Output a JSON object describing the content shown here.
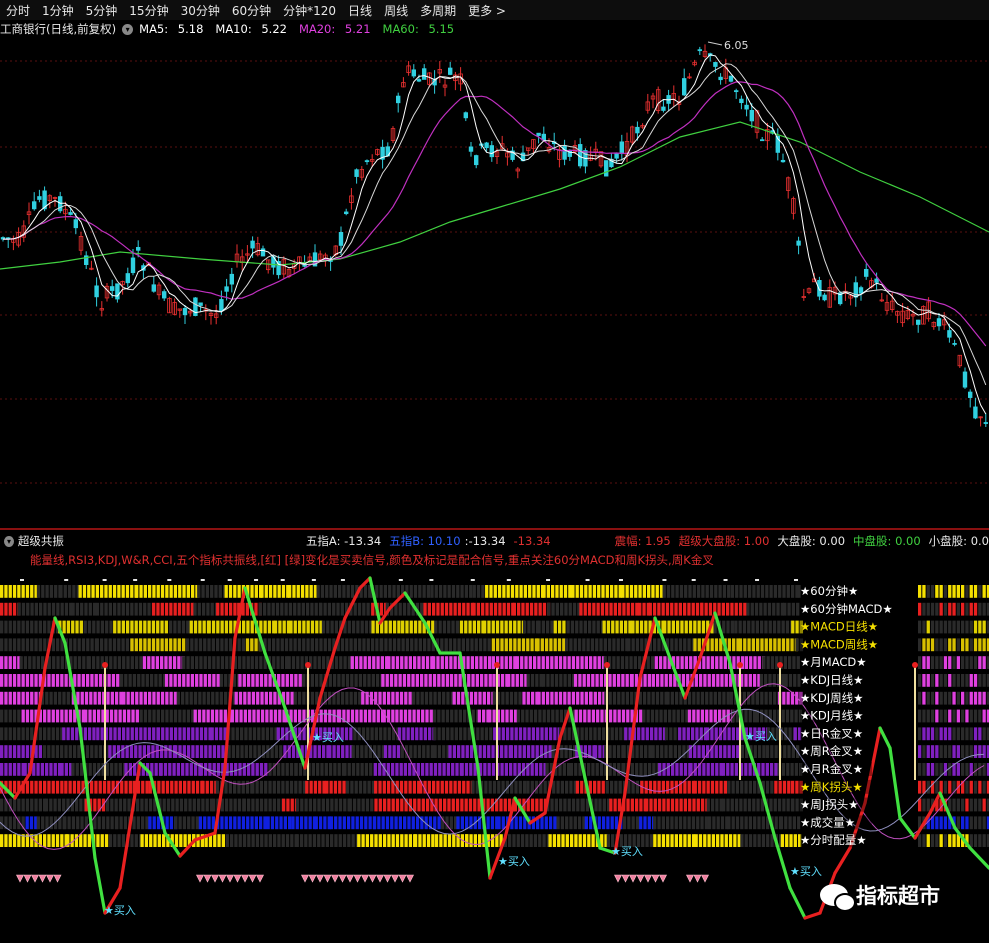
{
  "toolbar": {
    "items": [
      "分时",
      "1分钟",
      "5分钟",
      "15分钟",
      "30分钟",
      "60分钟",
      "分钟*120",
      "日线",
      "周线",
      "多周期",
      "更多 >"
    ]
  },
  "price_header": {
    "stock": "工商银行(日线,前复权)",
    "ma5_label": "MA5:",
    "ma5": "5.18",
    "ma10_label": "MA10:",
    "ma10": "5.22",
    "ma20_label": "MA20:",
    "ma20": "5.21",
    "ma60_label": "MA60:",
    "ma60": "5.15",
    "high_mark": "6.05",
    "colors": {
      "ma5": "#ffffff",
      "ma10": "#ffffff",
      "ma20": "#e040e0",
      "ma60": "#40d040"
    }
  },
  "indicator_header": {
    "name": "超级共振",
    "wz_a_label": "五指A:",
    "wz_a": "-13.34",
    "wz_b_label": "五指B:",
    "wz_b1": "10.10",
    "wz_b2": ":-13.34",
    "wz_b3": "-13.34",
    "amp_label": "震幅:",
    "amp": "1.95",
    "big_cap_label": "超级大盘股:",
    "big_cap": "1.00",
    "large_label": "大盘股:",
    "large": "0.00",
    "mid_label": "中盘股:",
    "mid": "0.00",
    "small_label": "小盘股:",
    "small": "0.0"
  },
  "indicator_desc": "能量线,RSI3,KDJ,W&R,CCI,五个指标共振线,[红] [绿]变化是买卖信号,颜色及标记是配合信号,重点关注60分MACD和周K拐头,周K金叉",
  "row_labels": [
    "★60分钟★",
    "★60分钟MACD★",
    "★MACD日线★",
    "★MACD周线★",
    "★月MACD★",
    "★KDJ日线★",
    "★KDJ周线★",
    "★KDJ月线★",
    "★日R金叉★",
    "★周R金叉★",
    "★月R金叉★",
    "★周K拐头★",
    "★周J拐头★",
    "★成交量★",
    "★分时配量★"
  ],
  "row_colors": [
    "#f5e000",
    "#e82020",
    "#e0d000",
    "#d8c000",
    "#e040e0",
    "#e040e0",
    "#e040e0",
    "#e040e0",
    "#8020c0",
    "#8020c0",
    "#8020c0",
    "#e82020",
    "#e82020",
    "#1020e0",
    "#f5e000"
  ],
  "buy_label": "买入",
  "watermark": "指标超市"
}
